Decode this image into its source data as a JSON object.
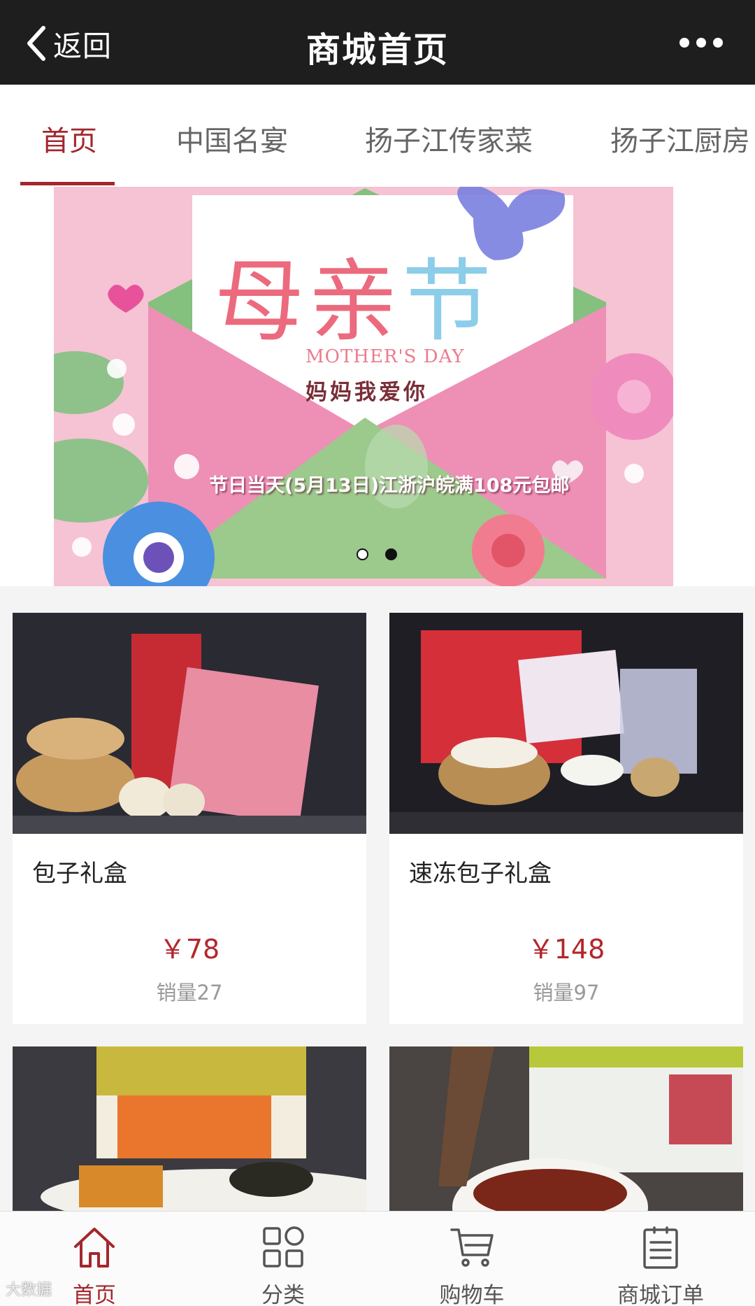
{
  "header": {
    "back_label": "返回",
    "title": "商城首页",
    "more_icon": "more-dots-icon"
  },
  "tabs": [
    {
      "label": "首页",
      "active": true
    },
    {
      "label": "中国名宴",
      "active": false
    },
    {
      "label": "扬子江传家菜",
      "active": false
    },
    {
      "label": "扬子江厨房",
      "active": false
    }
  ],
  "banner": {
    "title_part1": "母亲",
    "title_part2": "节",
    "subtitle_en": "MOTHER'S DAY",
    "subtitle_cn": "妈妈我爱你",
    "promo": "节日当天(5月13日)江浙沪皖满108元包邮",
    "slides_total": 2,
    "active_slide": 2
  },
  "products": [
    {
      "name": "包子礼盒",
      "price": "￥78",
      "sales": "销量27"
    },
    {
      "name": "速冻包子礼盒",
      "price": "￥148",
      "sales": "销量97"
    },
    {
      "name": "",
      "price": "",
      "sales": ""
    },
    {
      "name": "",
      "price": "",
      "sales": ""
    }
  ],
  "bottom_nav": [
    {
      "label": "首页",
      "icon": "home-icon",
      "active": true
    },
    {
      "label": "分类",
      "icon": "category-grid-icon",
      "active": false
    },
    {
      "label": "购物车",
      "icon": "shopping-cart-icon",
      "active": false
    },
    {
      "label": "商城订单",
      "icon": "order-list-icon",
      "active": false
    }
  ],
  "watermark": "大数据",
  "colors": {
    "accent": "#a3272d",
    "topbar": "#1e1e1e",
    "price": "#b3262c"
  }
}
